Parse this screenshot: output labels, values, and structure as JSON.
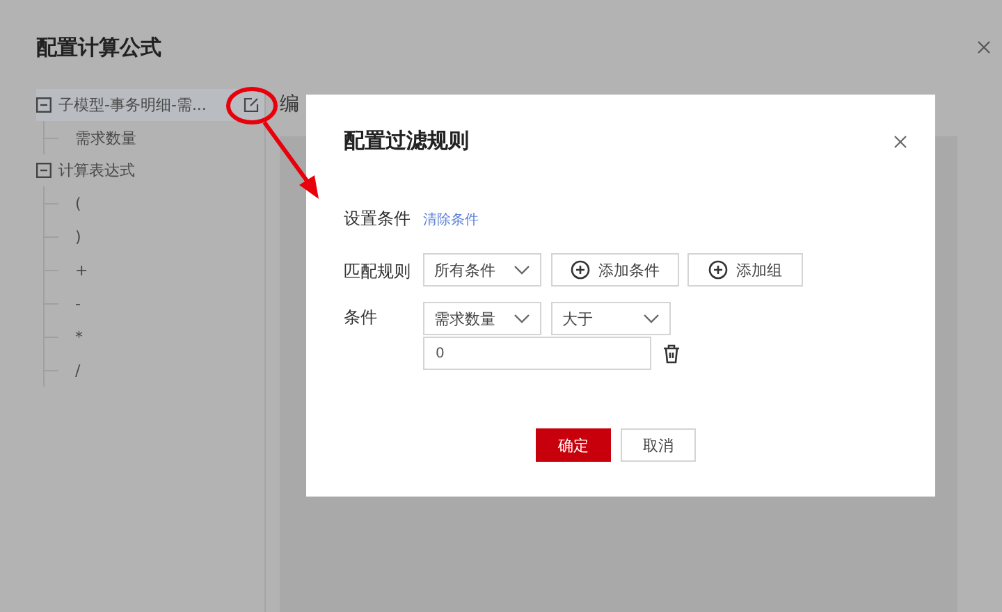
{
  "page": {
    "title": "配置计算公式",
    "editor_label": "编"
  },
  "tree": [
    {
      "label": "子模型-事务明细-需...",
      "expanded": true,
      "selected": true,
      "children": [
        {
          "label": "需求数量"
        }
      ]
    },
    {
      "label": "计算表达式",
      "expanded": true,
      "selected": false,
      "children": [
        {
          "label": "("
        },
        {
          "label": ")"
        },
        {
          "label": "+"
        },
        {
          "label": "-"
        },
        {
          "label": "*"
        },
        {
          "label": "/"
        }
      ]
    }
  ],
  "dialog": {
    "title": "配置过滤规则",
    "section_label": "设置条件",
    "clear_link": "清除条件",
    "match_row": {
      "label": "匹配规则",
      "select": "所有条件",
      "buttons": [
        "添加条件",
        "添加组"
      ]
    },
    "condition_row": {
      "label": "条件",
      "field": "需求数量",
      "operator": "大于",
      "value": "0"
    },
    "buttons": [
      {
        "label": "确定",
        "kind": "primary"
      },
      {
        "label": "取消",
        "kind": "default"
      }
    ]
  }
}
